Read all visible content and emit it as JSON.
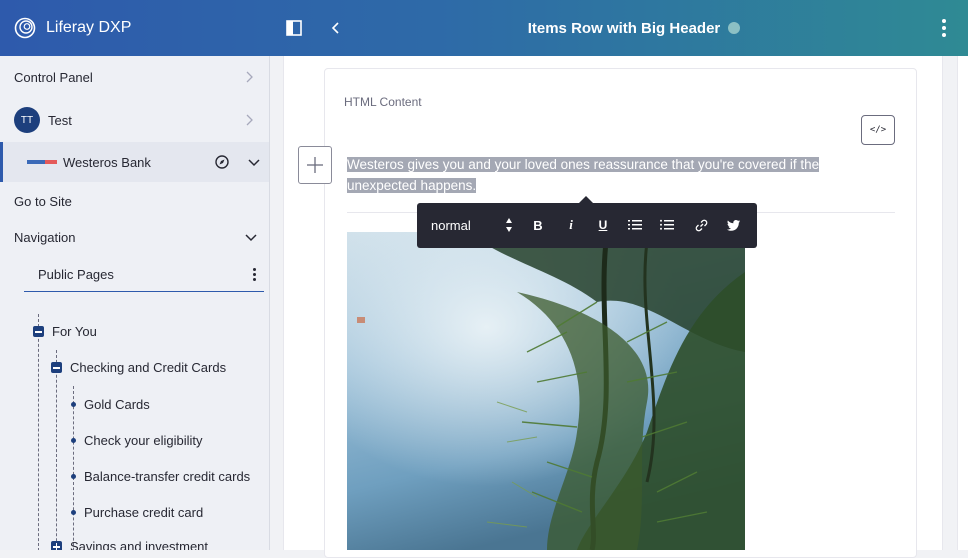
{
  "header": {
    "brand": "Liferay DXP",
    "page_title": "Items Row with Big Header"
  },
  "sidebar": {
    "control_panel": "Control Panel",
    "user": {
      "initials": "TT",
      "name": "Test"
    },
    "site": {
      "name": "Westeros Bank"
    },
    "go_to_site": "Go to Site",
    "navigation": "Navigation",
    "pages_select": "Public Pages",
    "tree": [
      {
        "label": "For You",
        "level": 0,
        "type": "collapse"
      },
      {
        "label": "Checking and Credit Cards",
        "level": 1,
        "type": "collapse"
      },
      {
        "label": "Gold Cards",
        "level": 2,
        "type": "leaf"
      },
      {
        "label": "Check your eligibility",
        "level": 2,
        "type": "leaf"
      },
      {
        "label": "Balance-transfer credit cards",
        "level": 2,
        "type": "leaf"
      },
      {
        "label": "Purchase credit card",
        "level": 2,
        "type": "leaf"
      },
      {
        "label": "Savings and investment",
        "level": 1,
        "type": "expand"
      }
    ]
  },
  "editor": {
    "fragment_label": "HTML Content",
    "selected_text_line1": "Westeros gives you and your loved ones reassurance that you're covered if the",
    "selected_text_line2": "unexpected happens.",
    "code_button_label": "</>"
  },
  "toolbar": {
    "format_value": "normal",
    "bold": "B",
    "italic": "i",
    "underline": "U"
  },
  "colors": {
    "accent": "#2e5aac",
    "toolbar_bg": "#272833",
    "selection": "#a4a8b4"
  }
}
